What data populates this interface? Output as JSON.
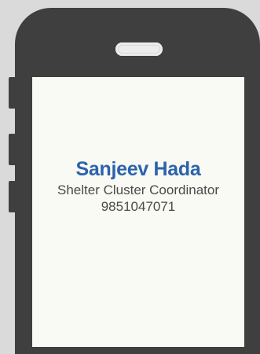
{
  "contact": {
    "name": "Sanjeev Hada",
    "role": "Shelter Cluster Coordinator",
    "phone": "9851047071"
  },
  "colors": {
    "background": "#dadada",
    "phone_body": "#3f3f3f",
    "screen": "#f9faf3",
    "name_accent": "#2b63ad",
    "text": "#4a4a4a"
  }
}
